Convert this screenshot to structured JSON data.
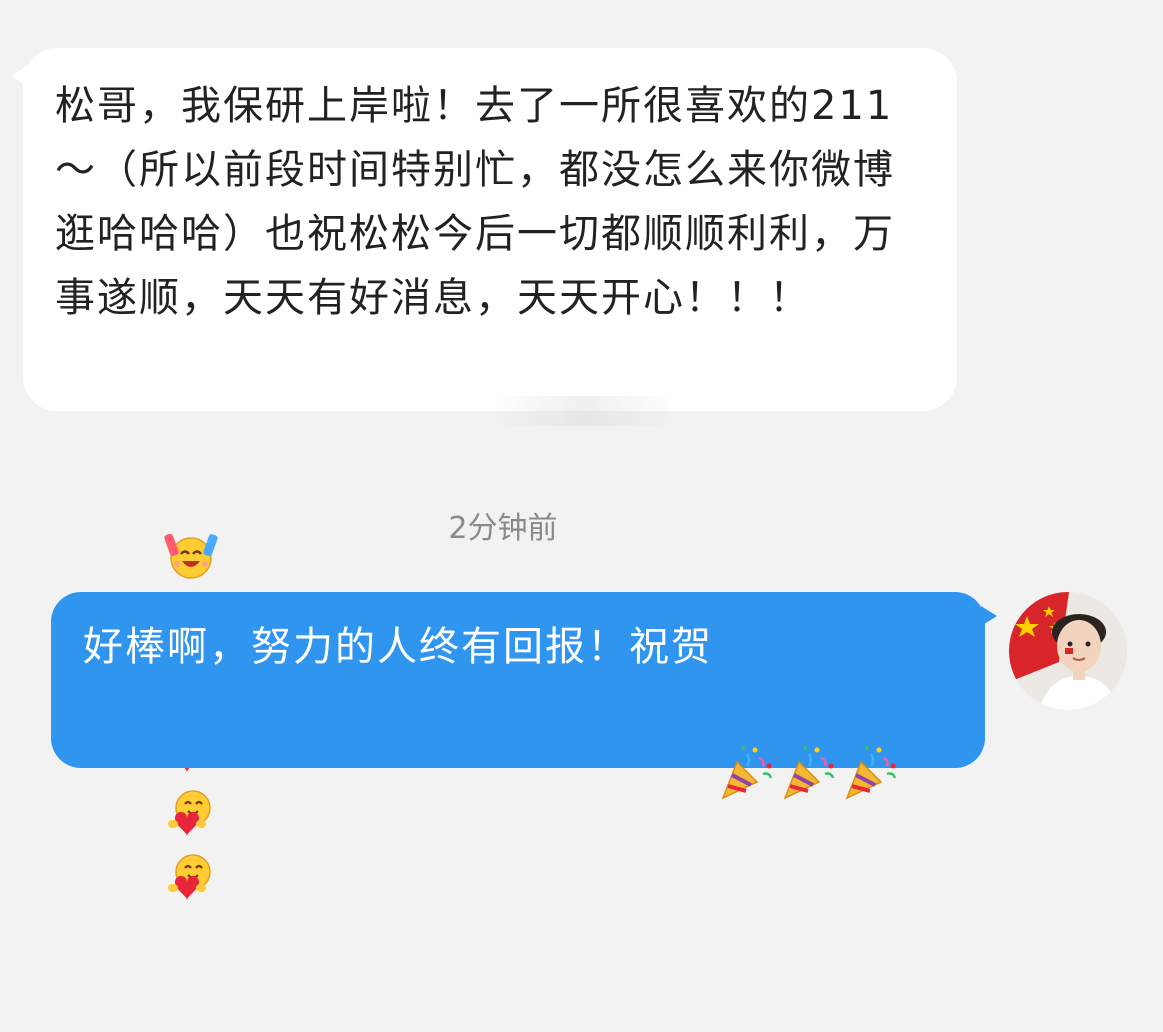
{
  "incoming_message": {
    "text": "松哥，我保研上岸啦！去了一所很喜欢的211～（所以前段时间特别忙，都没怎么来你微博逛哈哈哈）也祝松松今后一切都顺顺利利，万事遂顺，天天有好消息，天天开心！！！",
    "emojis": [
      "cheering-emoji",
      "cheering-emoji",
      "cheering-emoji",
      "hugging-heart-emoji",
      "hugging-heart-emoji",
      "hugging-heart-emoji"
    ]
  },
  "timestamp": "2分钟前",
  "outgoing_message": {
    "text": "好棒啊，努力的人终有回报！祝贺",
    "emojis": [
      "party-popper-emoji",
      "party-popper-emoji",
      "party-popper-emoji"
    ]
  },
  "avatar": {
    "icon": "user-avatar"
  },
  "colors": {
    "background": "#f2f2f2",
    "incoming_bubble": "#ffffff",
    "outgoing_bubble": "#2f95ee",
    "timestamp_text": "#8a8a8a"
  }
}
